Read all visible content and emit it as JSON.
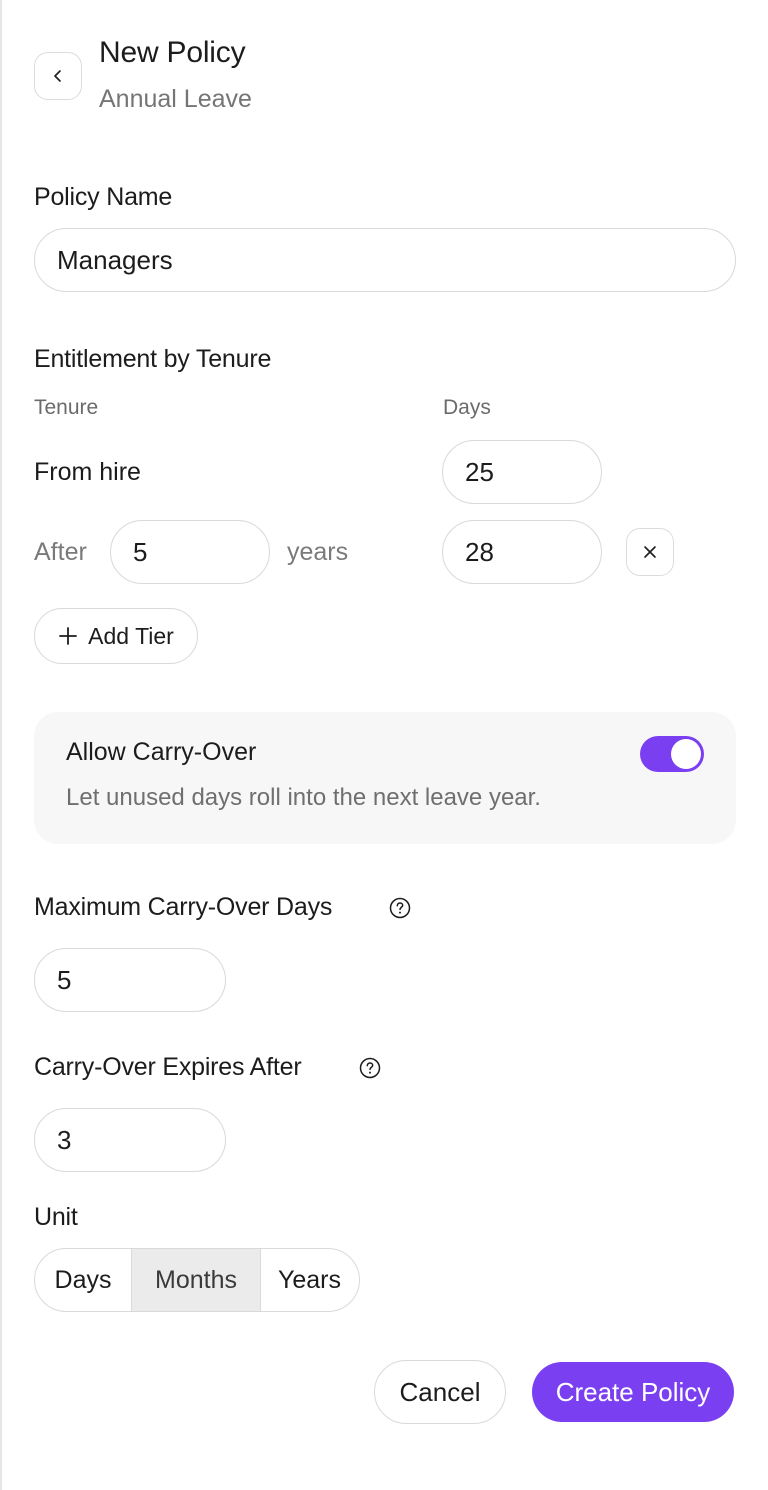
{
  "header": {
    "title": "New Policy",
    "subtitle": "Annual Leave",
    "back_icon": "chevron-left-icon"
  },
  "policy_name": {
    "label": "Policy Name",
    "value": "Managers"
  },
  "entitlement": {
    "label": "Entitlement by Tenure",
    "tenure_header": "Tenure",
    "days_header": "Days",
    "tiers": [
      {
        "tenure_text": "From hire",
        "days": "25"
      },
      {
        "prefix": "After",
        "years": "5",
        "suffix": "years",
        "days": "28",
        "remove_icon": "close-icon"
      }
    ],
    "add_tier_label": "Add Tier",
    "add_icon": "plus-icon"
  },
  "carry_over": {
    "title": "Allow Carry-Over",
    "description": "Let unused days roll into the next leave year.",
    "enabled": true,
    "accent_color": "#7b3ff2"
  },
  "max_carry_over": {
    "label": "Maximum Carry-Over Days",
    "value": "5",
    "help_icon": "help-circle-icon"
  },
  "expires_after": {
    "label": "Carry-Over Expires After",
    "value": "3",
    "help_icon": "help-circle-icon"
  },
  "unit": {
    "label": "Unit",
    "options": [
      "Days",
      "Months",
      "Years"
    ],
    "selected": "Months"
  },
  "actions": {
    "cancel_label": "Cancel",
    "create_label": "Create Policy"
  }
}
